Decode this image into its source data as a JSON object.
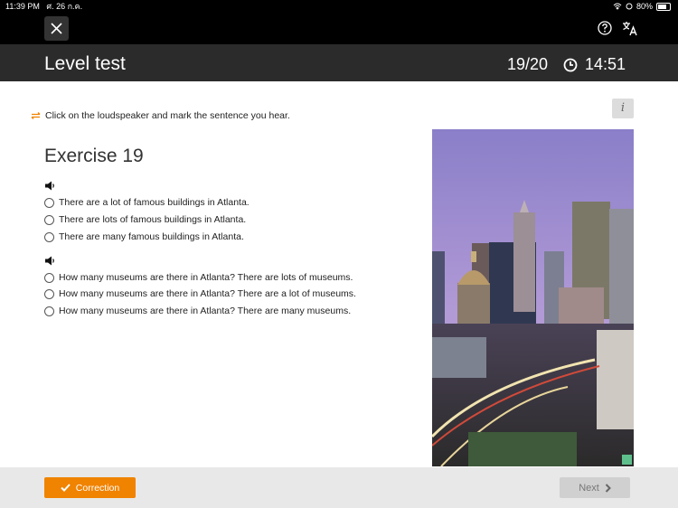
{
  "status_bar": {
    "time": "11:39 PM",
    "date": "ศ. 26 ก.ค.",
    "battery": "80%"
  },
  "top_bar": {
    "icons": [
      "close-icon",
      "help-icon",
      "translate-icon"
    ]
  },
  "header": {
    "title": "Level test",
    "progress": "19/20",
    "timer": "14:51"
  },
  "instruction": "Click on the loudspeaker and mark the sentence you hear.",
  "info_label": "i",
  "exercise": {
    "title": "Exercise 19",
    "groups": [
      {
        "options": [
          "There are a lot of famous buildings in Atlanta.",
          "There are lots of famous buildings in Atlanta.",
          "There are many famous buildings in Atlanta."
        ]
      },
      {
        "options": [
          "How many museums are there in Atlanta? There are lots of museums.",
          "How many museums are there in Atlanta? There are a lot of museums.",
          "How many museums are there in Atlanta? There are many museums."
        ]
      }
    ]
  },
  "footer": {
    "correction_label": "Correction",
    "next_label": "Next"
  },
  "colors": {
    "accent": "#f08300",
    "header_bg": "#2b2b2b",
    "footer_bg": "#e8e8e8"
  }
}
